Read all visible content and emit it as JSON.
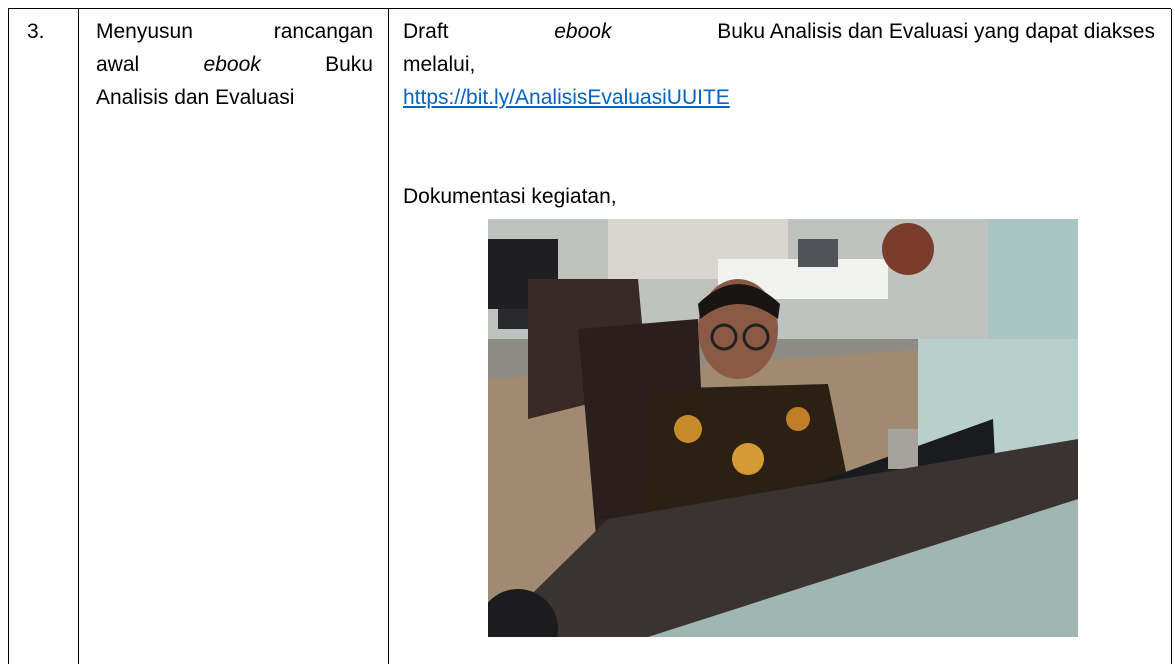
{
  "row": {
    "number": "3.",
    "activity": {
      "line1": [
        "Menyusun",
        "rancangan"
      ],
      "line2": [
        "awal",
        "ebook",
        "Buku"
      ],
      "line3": "Analisis dan Evaluasi"
    },
    "output": {
      "line1_prefix": "Draft",
      "line1_italic": "ebook",
      "line1_suffix": "Buku Analisis dan Evaluasi yang dapat diakses",
      "line2": "melalui,",
      "link": "https://bit.ly/AnalisisEvaluasiUUITE",
      "doc_label": "Dokumentasi kegiatan,"
    }
  },
  "colors": {
    "link": "#0563c1",
    "border": "#000000"
  }
}
